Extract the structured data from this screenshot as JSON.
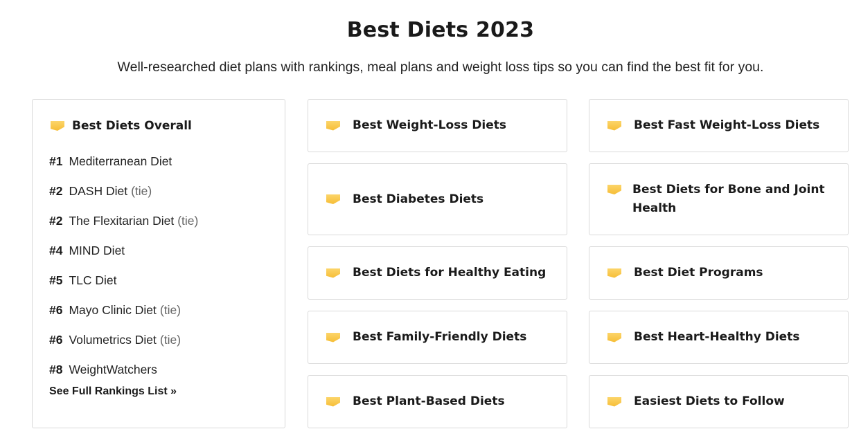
{
  "header": {
    "title": "Best Diets 2023",
    "subtitle": "Well-researched diet plans with rankings, meal plans and weight loss tips so you can find the best fit for you."
  },
  "overall": {
    "heading": "Best Diets Overall",
    "items": [
      {
        "rank": "#1",
        "name": "Mediterranean Diet",
        "tie": ""
      },
      {
        "rank": "#2",
        "name": "DASH Diet",
        "tie": "(tie)"
      },
      {
        "rank": "#2",
        "name": "The Flexitarian Diet",
        "tie": "(tie)"
      },
      {
        "rank": "#4",
        "name": "MIND Diet",
        "tie": ""
      },
      {
        "rank": "#5",
        "name": "TLC Diet",
        "tie": ""
      },
      {
        "rank": "#6",
        "name": "Mayo Clinic Diet",
        "tie": "(tie)"
      },
      {
        "rank": "#6",
        "name": "Volumetrics Diet",
        "tie": "(tie)"
      },
      {
        "rank": "#8",
        "name": "WeightWatchers",
        "tie": ""
      }
    ],
    "see_full": "See Full Rankings List »"
  },
  "categories": {
    "left": [
      "Best Weight-Loss Diets",
      "Best Diabetes Diets",
      "Best Diets for Healthy Eating",
      "Best Family-Friendly Diets",
      "Best Plant-Based Diets"
    ],
    "right": [
      "Best Fast Weight-Loss Diets",
      "Best Diets for Bone and Joint Health",
      "Best Diet Programs",
      "Best Heart-Healthy Diets",
      "Easiest Diets to Follow"
    ]
  },
  "colors": {
    "ribbon": "#f6bd35",
    "border": "#d9d9d9",
    "text": "#1a1a1a",
    "tie": "#666666"
  },
  "icons": {
    "ribbon": "ribbon-icon"
  }
}
